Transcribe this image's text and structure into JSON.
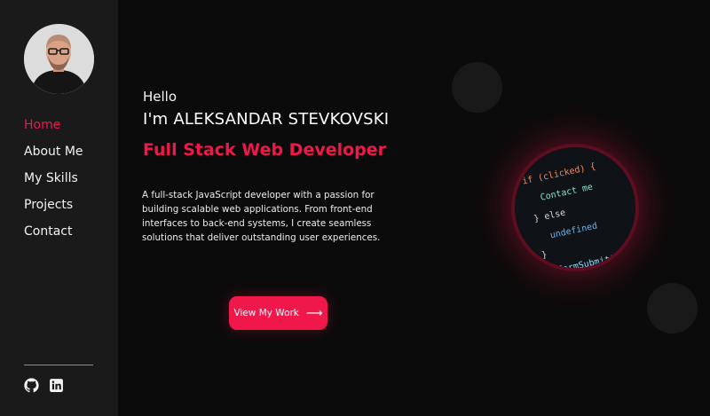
{
  "sidebar": {
    "avatar_icon": "person-avatar",
    "nav": [
      {
        "label": "Home",
        "active": true
      },
      {
        "label": "About Me",
        "active": false
      },
      {
        "label": "My Skills",
        "active": false
      },
      {
        "label": "Projects",
        "active": false
      },
      {
        "label": "Contact",
        "active": false
      }
    ],
    "social": [
      {
        "icon": "github-icon"
      },
      {
        "icon": "linkedin-icon"
      }
    ]
  },
  "hero": {
    "greeting": "Hello",
    "name": "I'm ALEKSANDAR STEVKOVSKI",
    "role": "Full Stack Web Developer",
    "description": "A full-stack JavaScript developer with a passion for building scalable web applications. From front-end interfaces to back-end systems, I create seamless solutions that deliver outstanding user experiences.",
    "cta_label": "View My Work",
    "cta_icon": "arrow-right-icon"
  },
  "code_image": {
    "lines": [
      "if (clicked) {",
      "Contact me",
      "} else",
      "undefined",
      "}",
      "let formSubmitted ="
    ]
  },
  "colors": {
    "accent": "#f0174a",
    "background": "#0c0b0b",
    "sidebar": "#1b1a1a"
  }
}
